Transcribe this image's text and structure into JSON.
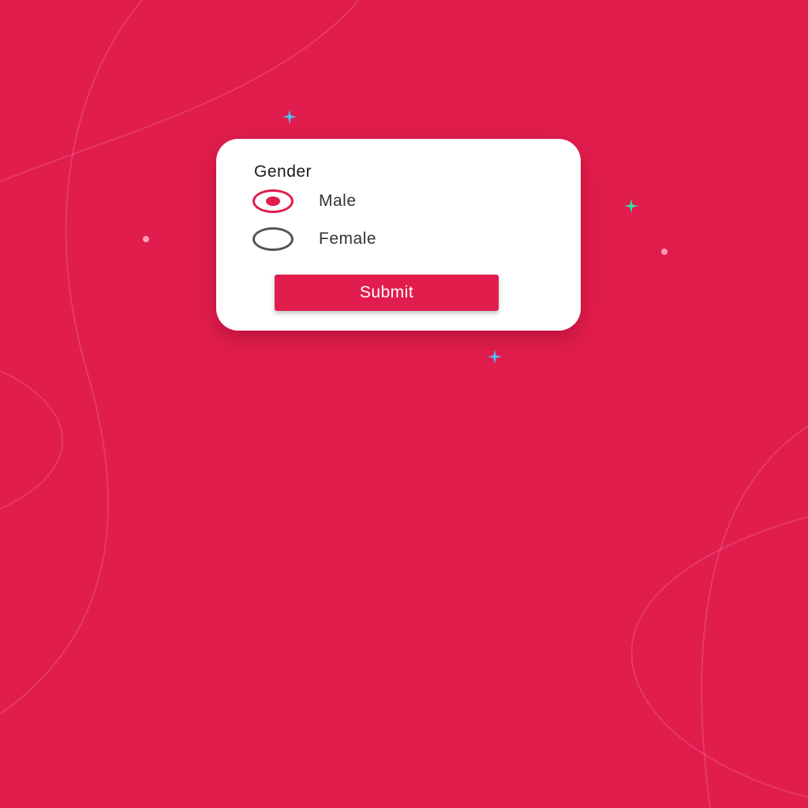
{
  "colors": {
    "background": "#e11d4d",
    "card": "#ffffff",
    "accent": "#e11d4d",
    "sparkle_blue": "#4fc3f7",
    "sparkle_green": "#2ee6a8"
  },
  "form": {
    "group_label": "Gender",
    "options": [
      {
        "label": "Male",
        "checked": true
      },
      {
        "label": "Female",
        "checked": false
      }
    ],
    "submit_label": "Submit"
  }
}
